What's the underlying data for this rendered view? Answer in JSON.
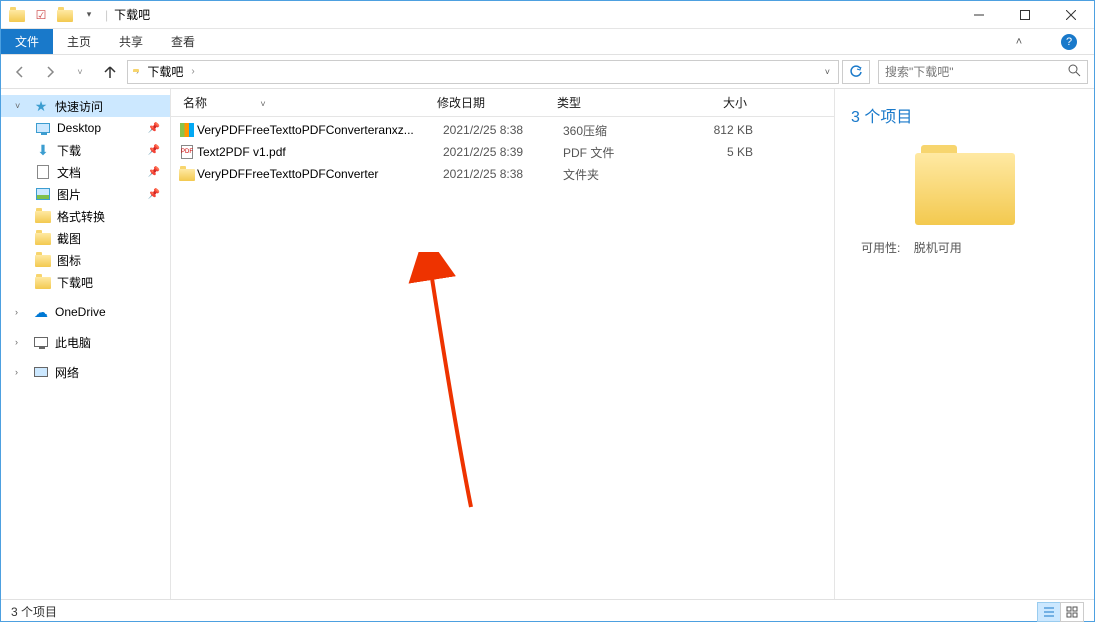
{
  "window": {
    "title": "下载吧"
  },
  "ribbon": {
    "file": "文件",
    "tabs": [
      "主页",
      "共享",
      "查看"
    ]
  },
  "breadcrumb": {
    "current": "下载吧"
  },
  "search": {
    "placeholder": "搜索\"下载吧\""
  },
  "sidebar": {
    "quick": "快速访问",
    "items": [
      {
        "label": "Desktop",
        "pin": true
      },
      {
        "label": "下载",
        "pin": true
      },
      {
        "label": "文档",
        "pin": true
      },
      {
        "label": "图片",
        "pin": true
      },
      {
        "label": "格式转换",
        "pin": false
      },
      {
        "label": "截图",
        "pin": false
      },
      {
        "label": "图标",
        "pin": false
      },
      {
        "label": "下载吧",
        "pin": false
      }
    ],
    "onedrive": "OneDrive",
    "thispc": "此电脑",
    "network": "网络"
  },
  "columns": {
    "name": "名称",
    "date": "修改日期",
    "type": "类型",
    "size": "大小"
  },
  "files": [
    {
      "name": "VeryPDFFreeTexttoPDFConverteranxz...",
      "date": "2021/2/25 8:38",
      "type": "360压缩",
      "size": "812 KB",
      "icon": "zip"
    },
    {
      "name": "Text2PDF v1.pdf",
      "date": "2021/2/25 8:39",
      "type": "PDF 文件",
      "size": "5 KB",
      "icon": "pdf"
    },
    {
      "name": "VeryPDFFreeTexttoPDFConverter",
      "date": "2021/2/25 8:38",
      "type": "文件夹",
      "size": "",
      "icon": "folder"
    }
  ],
  "preview": {
    "heading": "3 个项目",
    "meta_label": "可用性:",
    "meta_value": "脱机可用"
  },
  "status": {
    "text": "3 个项目"
  }
}
